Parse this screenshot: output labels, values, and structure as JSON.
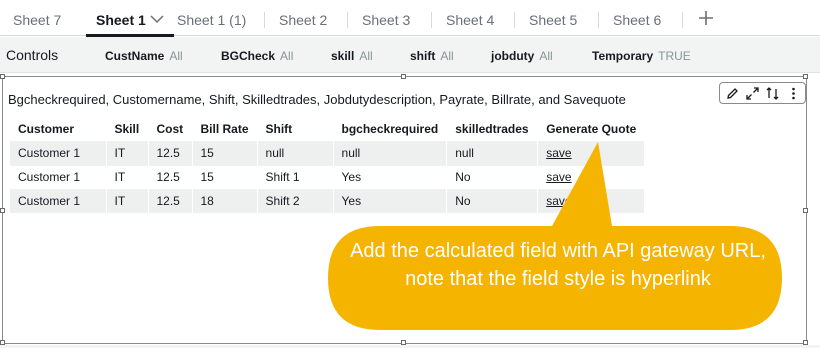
{
  "tabs": [
    {
      "label": "Sheet 7",
      "active": false
    },
    {
      "label": "Sheet 1",
      "active": true
    },
    {
      "label": "Sheet 1 (1)",
      "active": false
    },
    {
      "label": "Sheet 2",
      "active": false
    },
    {
      "label": "Sheet 3",
      "active": false
    },
    {
      "label": "Sheet 4",
      "active": false
    },
    {
      "label": "Sheet 5",
      "active": false
    },
    {
      "label": "Sheet 6",
      "active": false
    }
  ],
  "controls": {
    "title": "Controls",
    "items": [
      {
        "name": "CustName",
        "value": "All"
      },
      {
        "name": "BGCheck",
        "value": "All"
      },
      {
        "name": "skill",
        "value": "All"
      },
      {
        "name": "shift",
        "value": "All"
      },
      {
        "name": "jobduty",
        "value": "All"
      },
      {
        "name": "Temporary",
        "value": "TRUE"
      }
    ]
  },
  "visual": {
    "title": "Bgcheckrequired, Customername, Shift, Skilledtrades, Jobdutydescription, Payrate, Billrate, and Savequote",
    "toolbar_icons": [
      "pencil-icon",
      "expand-icon",
      "swap-icon",
      "more-icon"
    ]
  },
  "table": {
    "headers": [
      "Customer",
      "Skill",
      "Cost",
      "Bill Rate",
      "Shift",
      "bgcheckrequired",
      "skilledtrades",
      "Generate Quote"
    ],
    "rows": [
      [
        "Customer 1",
        "IT",
        "12.5",
        "15",
        "null",
        "null",
        "null",
        "save"
      ],
      [
        "Customer 1",
        "IT",
        "12.5",
        "15",
        "Shift 1",
        "Yes",
        "No",
        "save"
      ],
      [
        "Customer 1",
        "IT",
        "12.5",
        "18",
        "Shift 2",
        "Yes",
        "No",
        "save"
      ]
    ]
  },
  "callout": {
    "text": "Add the calculated field with API gateway URL, note that the field style is hyperlink",
    "color": "#F5B400"
  }
}
